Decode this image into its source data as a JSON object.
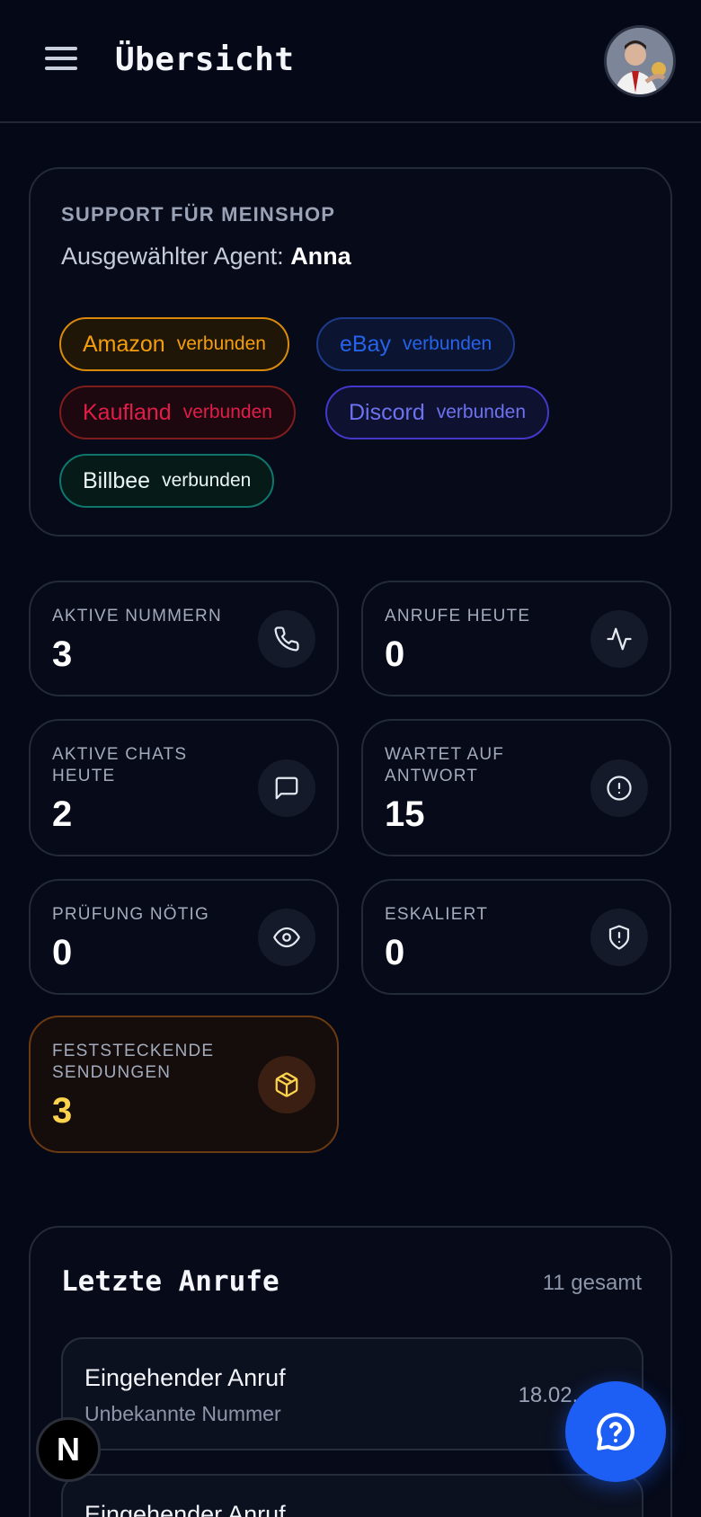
{
  "header": {
    "title": "Übersicht"
  },
  "support": {
    "heading": "SUPPORT FÜR MEINSHOP",
    "agent_prefix": "Ausgewählter Agent:",
    "agent_name": "Anna",
    "integrations": [
      {
        "name": "Amazon",
        "status": "verbunden",
        "color": "#f59e0b"
      },
      {
        "name": "eBay",
        "status": "verbunden",
        "color": "#2563eb"
      },
      {
        "name": "Kaufland",
        "status": "verbunden",
        "color": "#dc2626"
      },
      {
        "name": "Discord",
        "status": "verbunden",
        "color": "#6366f1"
      },
      {
        "name": "Billbee",
        "status": "verbunden",
        "color": "#10b981"
      }
    ]
  },
  "stats": [
    {
      "label": "AKTIVE NUMMERN",
      "value": "3",
      "icon": "phone-icon"
    },
    {
      "label": "ANRUFE HEUTE",
      "value": "0",
      "icon": "activity-icon"
    },
    {
      "label": "AKTIVE CHATS HEUTE",
      "value": "2",
      "icon": "chat-icon"
    },
    {
      "label": "WARTET AUF ANTWORT",
      "value": "15",
      "icon": "alert-circle-icon"
    },
    {
      "label": "PRÜFUNG NÖTIG",
      "value": "0",
      "icon": "eye-icon"
    },
    {
      "label": "ESKALIERT",
      "value": "0",
      "icon": "shield-alert-icon"
    },
    {
      "label": "FESTSTECKENDE SENDUNGEN",
      "value": "3",
      "icon": "package-icon",
      "accent": "#fcd34d"
    }
  ],
  "calls": {
    "title": "Letzte Anrufe",
    "count_label": "11 gesamt",
    "items": [
      {
        "title": "Eingehender Anruf",
        "subtitle": "Unbekannte Nummer",
        "time": "18.02., 09:"
      },
      {
        "title": "Eingehender Anruf",
        "subtitle": "",
        "time": ""
      }
    ]
  },
  "help_fab": {
    "icon": "help-circle-icon"
  },
  "dev_badge": {
    "label": "N"
  }
}
